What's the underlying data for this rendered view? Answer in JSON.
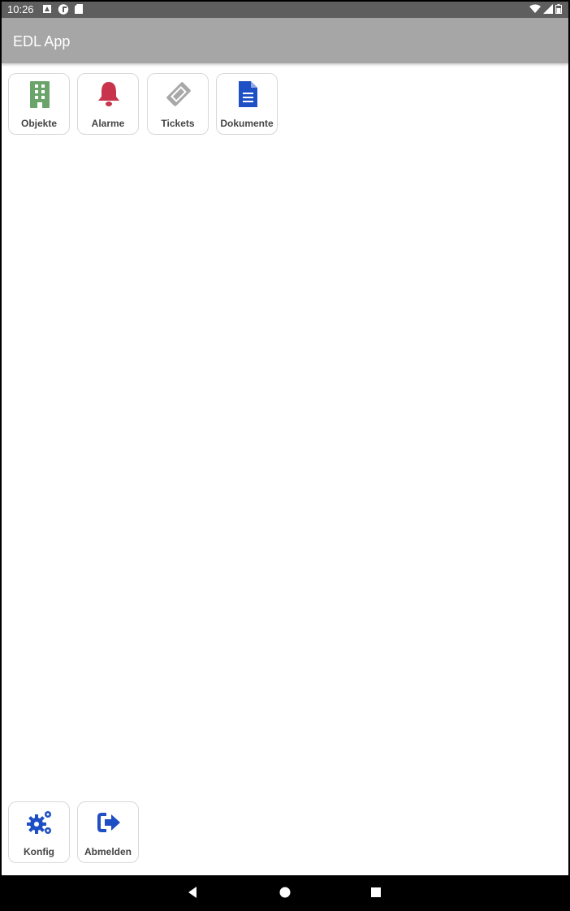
{
  "status_bar": {
    "time": "10:26",
    "left_icons": [
      "a-icon",
      "circle-app-icon",
      "sd-card-icon"
    ],
    "right_icons": [
      "wifi-icon",
      "signal-icon",
      "battery-icon"
    ]
  },
  "app_bar": {
    "title": "EDL App"
  },
  "tiles_top": [
    {
      "label": "Objekte",
      "icon": "building-icon",
      "color": "#6aa46a"
    },
    {
      "label": "Alarme",
      "icon": "bell-icon",
      "color": "#c8344c"
    },
    {
      "label": "Tickets",
      "icon": "ticket-icon",
      "color": "#a8a8a8"
    },
    {
      "label": "Dokumente",
      "icon": "document-icon",
      "color": "#1f4fc4"
    }
  ],
  "tiles_bottom": [
    {
      "label": "Konfig",
      "icon": "gears-icon",
      "color": "#1f4fc4"
    },
    {
      "label": "Abmelden",
      "icon": "logout-icon",
      "color": "#1f4fc4"
    }
  ],
  "nav_bar": [
    "back-icon",
    "home-icon",
    "recents-icon"
  ]
}
